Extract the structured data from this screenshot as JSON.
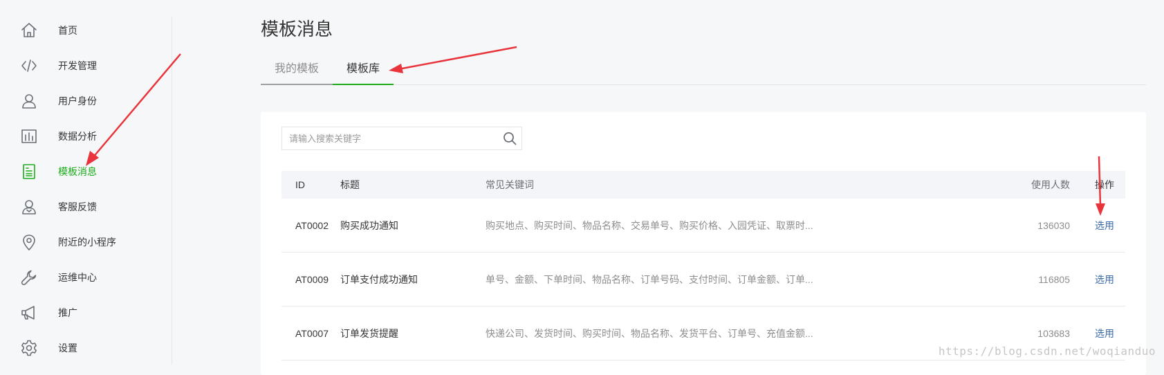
{
  "sidebar": {
    "items": [
      {
        "label": "首页",
        "icon": "home-icon",
        "active": false
      },
      {
        "label": "开发管理",
        "icon": "code-icon",
        "active": false
      },
      {
        "label": "用户身份",
        "icon": "user-icon",
        "active": false
      },
      {
        "label": "数据分析",
        "icon": "chart-icon",
        "active": false
      },
      {
        "label": "模板消息",
        "icon": "document-icon",
        "active": true
      },
      {
        "label": "客服反馈",
        "icon": "support-icon",
        "active": false
      },
      {
        "label": "附近的小程序",
        "icon": "location-pin-icon",
        "active": false
      },
      {
        "label": "运维中心",
        "icon": "wrench-icon",
        "active": false
      },
      {
        "label": "推广",
        "icon": "megaphone-icon",
        "active": false
      },
      {
        "label": "设置",
        "icon": "gear-icon",
        "active": false
      }
    ],
    "active_color": "#1aad19"
  },
  "main": {
    "title": "模板消息",
    "tabs": [
      {
        "label": "我的模板",
        "active": false
      },
      {
        "label": "模板库",
        "active": true
      }
    ],
    "search": {
      "placeholder": "请输入搜索关键字"
    },
    "table": {
      "headers": {
        "id": "ID",
        "title": "标题",
        "keywords": "常见关键词",
        "users": "使用人数",
        "op": "操作"
      },
      "rows": [
        {
          "id": "AT0002",
          "title": "购买成功通知",
          "keywords": "购买地点、购买时间、物品名称、交易单号、购买价格、入园凭证、取票时...",
          "users": "136030",
          "op": "选用"
        },
        {
          "id": "AT0009",
          "title": "订单支付成功通知",
          "keywords": "单号、金额、下单时间、物品名称、订单号码、支付时间、订单金额、订单...",
          "users": "116805",
          "op": "选用"
        },
        {
          "id": "AT0007",
          "title": "订单发货提醒",
          "keywords": "快递公司、发货时间、购买时间、物品名称、发货平台、订单号、充值金额...",
          "users": "103683",
          "op": "选用"
        }
      ]
    }
  },
  "watermark": "https://blog.csdn.net/woqianduo",
  "colors": {
    "accent": "#1aad19",
    "link": "#3a6aa6",
    "annotation_arrow": "#e8343a"
  }
}
